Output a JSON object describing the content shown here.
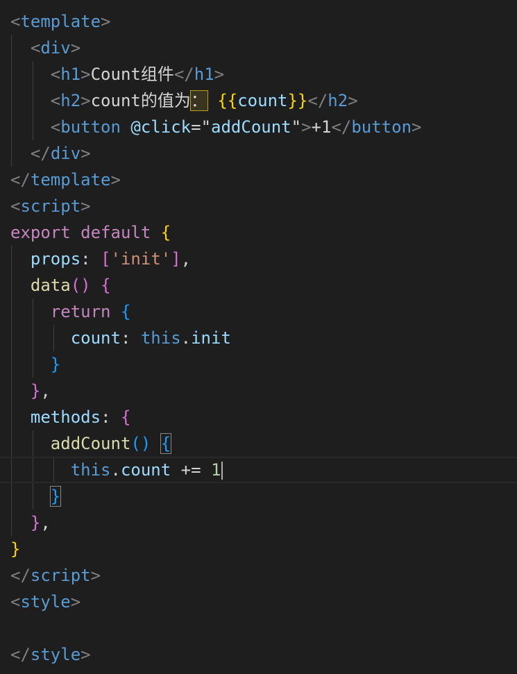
{
  "editor": {
    "background": "#1e1e1e",
    "language": "vue",
    "cursor_line": 18,
    "lines": [
      [
        {
          "t": "<",
          "c": "punct"
        },
        {
          "t": "template",
          "c": "tag"
        },
        {
          "t": ">",
          "c": "punct"
        }
      ],
      [
        {
          "t": "  "
        },
        {
          "t": "<",
          "c": "punct"
        },
        {
          "t": "div",
          "c": "tag"
        },
        {
          "t": ">",
          "c": "punct"
        }
      ],
      [
        {
          "t": "    "
        },
        {
          "t": "<",
          "c": "punct"
        },
        {
          "t": "h1",
          "c": "tag"
        },
        {
          "t": ">",
          "c": "punct"
        },
        {
          "t": "Count组件",
          "c": "text"
        },
        {
          "t": "</",
          "c": "punct"
        },
        {
          "t": "h1",
          "c": "tag"
        },
        {
          "t": ">",
          "c": "punct"
        }
      ],
      [
        {
          "t": "    "
        },
        {
          "t": "<",
          "c": "punct"
        },
        {
          "t": "h2",
          "c": "tag"
        },
        {
          "t": ">",
          "c": "punct"
        },
        {
          "t": "count的值为",
          "c": "text"
        },
        {
          "t": "：",
          "c": "text",
          "box": "hl"
        },
        {
          "t": " ",
          "c": "text"
        },
        {
          "t": "{{",
          "c": "b1"
        },
        {
          "t": "count",
          "c": "attr"
        },
        {
          "t": "}}",
          "c": "b1"
        },
        {
          "t": "</",
          "c": "punct"
        },
        {
          "t": "h2",
          "c": "tag"
        },
        {
          "t": ">",
          "c": "punct"
        }
      ],
      [
        {
          "t": "    "
        },
        {
          "t": "<",
          "c": "punct"
        },
        {
          "t": "button",
          "c": "tag"
        },
        {
          "t": " "
        },
        {
          "t": "@click",
          "c": "attr"
        },
        {
          "t": "=",
          "c": "text"
        },
        {
          "t": "\"",
          "c": "text"
        },
        {
          "t": "addCount",
          "c": "attr"
        },
        {
          "t": "\"",
          "c": "text"
        },
        {
          "t": ">",
          "c": "punct"
        },
        {
          "t": "+1",
          "c": "text"
        },
        {
          "t": "</",
          "c": "punct"
        },
        {
          "t": "button",
          "c": "tag"
        },
        {
          "t": ">",
          "c": "punct"
        }
      ],
      [
        {
          "t": "  "
        },
        {
          "t": "</",
          "c": "punct"
        },
        {
          "t": "div",
          "c": "tag"
        },
        {
          "t": ">",
          "c": "punct"
        }
      ],
      [
        {
          "t": "</",
          "c": "punct"
        },
        {
          "t": "template",
          "c": "tag"
        },
        {
          "t": ">",
          "c": "punct"
        }
      ],
      [
        {
          "t": "<",
          "c": "punct"
        },
        {
          "t": "script",
          "c": "tag"
        },
        {
          "t": ">",
          "c": "punct"
        }
      ],
      [
        {
          "t": "export",
          "c": "keyword"
        },
        {
          "t": " "
        },
        {
          "t": "default",
          "c": "keyword"
        },
        {
          "t": " "
        },
        {
          "t": "{",
          "c": "b1"
        }
      ],
      [
        {
          "t": "  "
        },
        {
          "t": "props",
          "c": "attr"
        },
        {
          "t": ": ",
          "c": "text"
        },
        {
          "t": "[",
          "c": "b2"
        },
        {
          "t": "'init'",
          "c": "str"
        },
        {
          "t": "]",
          "c": "b2"
        },
        {
          "t": ",",
          "c": "text"
        }
      ],
      [
        {
          "t": "  "
        },
        {
          "t": "data",
          "c": "fn"
        },
        {
          "t": "()",
          "c": "b2"
        },
        {
          "t": " "
        },
        {
          "t": "{",
          "c": "b2"
        }
      ],
      [
        {
          "t": "    "
        },
        {
          "t": "return",
          "c": "keyword"
        },
        {
          "t": " "
        },
        {
          "t": "{",
          "c": "b3"
        }
      ],
      [
        {
          "t": "      "
        },
        {
          "t": "count",
          "c": "attr"
        },
        {
          "t": ": ",
          "c": "text"
        },
        {
          "t": "this",
          "c": "blue"
        },
        {
          "t": ".",
          "c": "text"
        },
        {
          "t": "init",
          "c": "attr"
        }
      ],
      [
        {
          "t": "    "
        },
        {
          "t": "}",
          "c": "b3"
        }
      ],
      [
        {
          "t": "  "
        },
        {
          "t": "}",
          "c": "b2"
        },
        {
          "t": ",",
          "c": "text"
        }
      ],
      [
        {
          "t": "  "
        },
        {
          "t": "methods",
          "c": "attr"
        },
        {
          "t": ": ",
          "c": "text"
        },
        {
          "t": "{",
          "c": "b2"
        }
      ],
      [
        {
          "t": "    "
        },
        {
          "t": "addCount",
          "c": "fn"
        },
        {
          "t": "()",
          "c": "b3"
        },
        {
          "t": " "
        },
        {
          "t": "{",
          "c": "b3",
          "box": "match"
        }
      ],
      [
        {
          "t": "      "
        },
        {
          "t": "this",
          "c": "blue"
        },
        {
          "t": ".",
          "c": "text"
        },
        {
          "t": "count",
          "c": "attr"
        },
        {
          "t": " += ",
          "c": "text"
        },
        {
          "t": "1",
          "c": "num"
        },
        {
          "cursor": true
        }
      ],
      [
        {
          "t": "    "
        },
        {
          "t": "}",
          "c": "b3",
          "box": "match"
        }
      ],
      [
        {
          "t": "  "
        },
        {
          "t": "}",
          "c": "b2"
        },
        {
          "t": ",",
          "c": "text"
        }
      ],
      [
        {
          "t": "}",
          "c": "b1"
        }
      ],
      [
        {
          "t": "</",
          "c": "punct"
        },
        {
          "t": "script",
          "c": "tag"
        },
        {
          "t": ">",
          "c": "punct"
        }
      ],
      [
        {
          "t": "<",
          "c": "punct"
        },
        {
          "t": "style",
          "c": "tag"
        },
        {
          "t": ">",
          "c": "punct"
        }
      ],
      [],
      [
        {
          "t": "</",
          "c": "punct"
        },
        {
          "t": "style",
          "c": "tag"
        },
        {
          "t": ">",
          "c": "punct"
        }
      ]
    ]
  }
}
